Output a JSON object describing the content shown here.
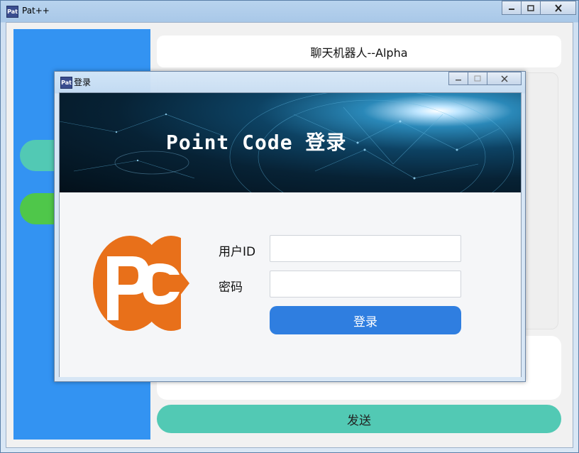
{
  "app": {
    "title": "Pat++",
    "icon": "app-icon",
    "icon_text": "Pat"
  },
  "chat": {
    "title": "聊天机器人--Alpha",
    "send_label": "发送"
  },
  "sidebar": {
    "color": "#3393f2",
    "pills": [
      {
        "name": "sidebar-pill-teal",
        "color": "#52c9b4"
      },
      {
        "name": "sidebar-pill-green",
        "color": "#4fc74a"
      }
    ]
  },
  "login_dialog": {
    "title": "登录",
    "banner_text": "Point Code 登录",
    "user_id_label": "用户ID",
    "user_id_value": "",
    "password_label": "密码",
    "password_value": "",
    "login_button": "登录",
    "logo": "point-code-logo"
  },
  "colors": {
    "accent_blue": "#2f7ee0",
    "send_teal": "#52c9b4",
    "logo_orange": "#e8701a"
  }
}
